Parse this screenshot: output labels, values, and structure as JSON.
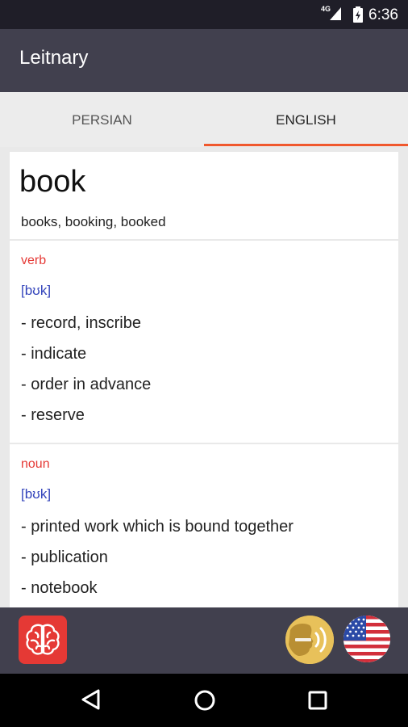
{
  "status_bar": {
    "network": "4G",
    "time": "6:36"
  },
  "app_bar": {
    "title": "Leitnary"
  },
  "tabs": [
    {
      "label": "PERSIAN",
      "selected": false
    },
    {
      "label": "ENGLISH",
      "selected": true
    }
  ],
  "entry": {
    "word": "book",
    "forms": "books, booking, booked",
    "senses": [
      {
        "pos": "verb",
        "ipa": "[bʊk]",
        "definitions": [
          "- record, inscribe",
          "- indicate",
          "- order in advance",
          "- reserve"
        ]
      },
      {
        "pos": "noun",
        "ipa": "[bʊk]",
        "definitions": [
          "- printed work which is bound together",
          "- publication",
          "- notebook"
        ]
      }
    ]
  },
  "bottom_bar": {
    "brain_icon": "brain-icon",
    "speak_icon": "speaker-voice-icon",
    "flag_icon": "us-flag-icon"
  },
  "colors": {
    "accent": "#f0582d",
    "pos": "#e53935",
    "ipa": "#3344bb",
    "app_bar": "#41404e"
  }
}
